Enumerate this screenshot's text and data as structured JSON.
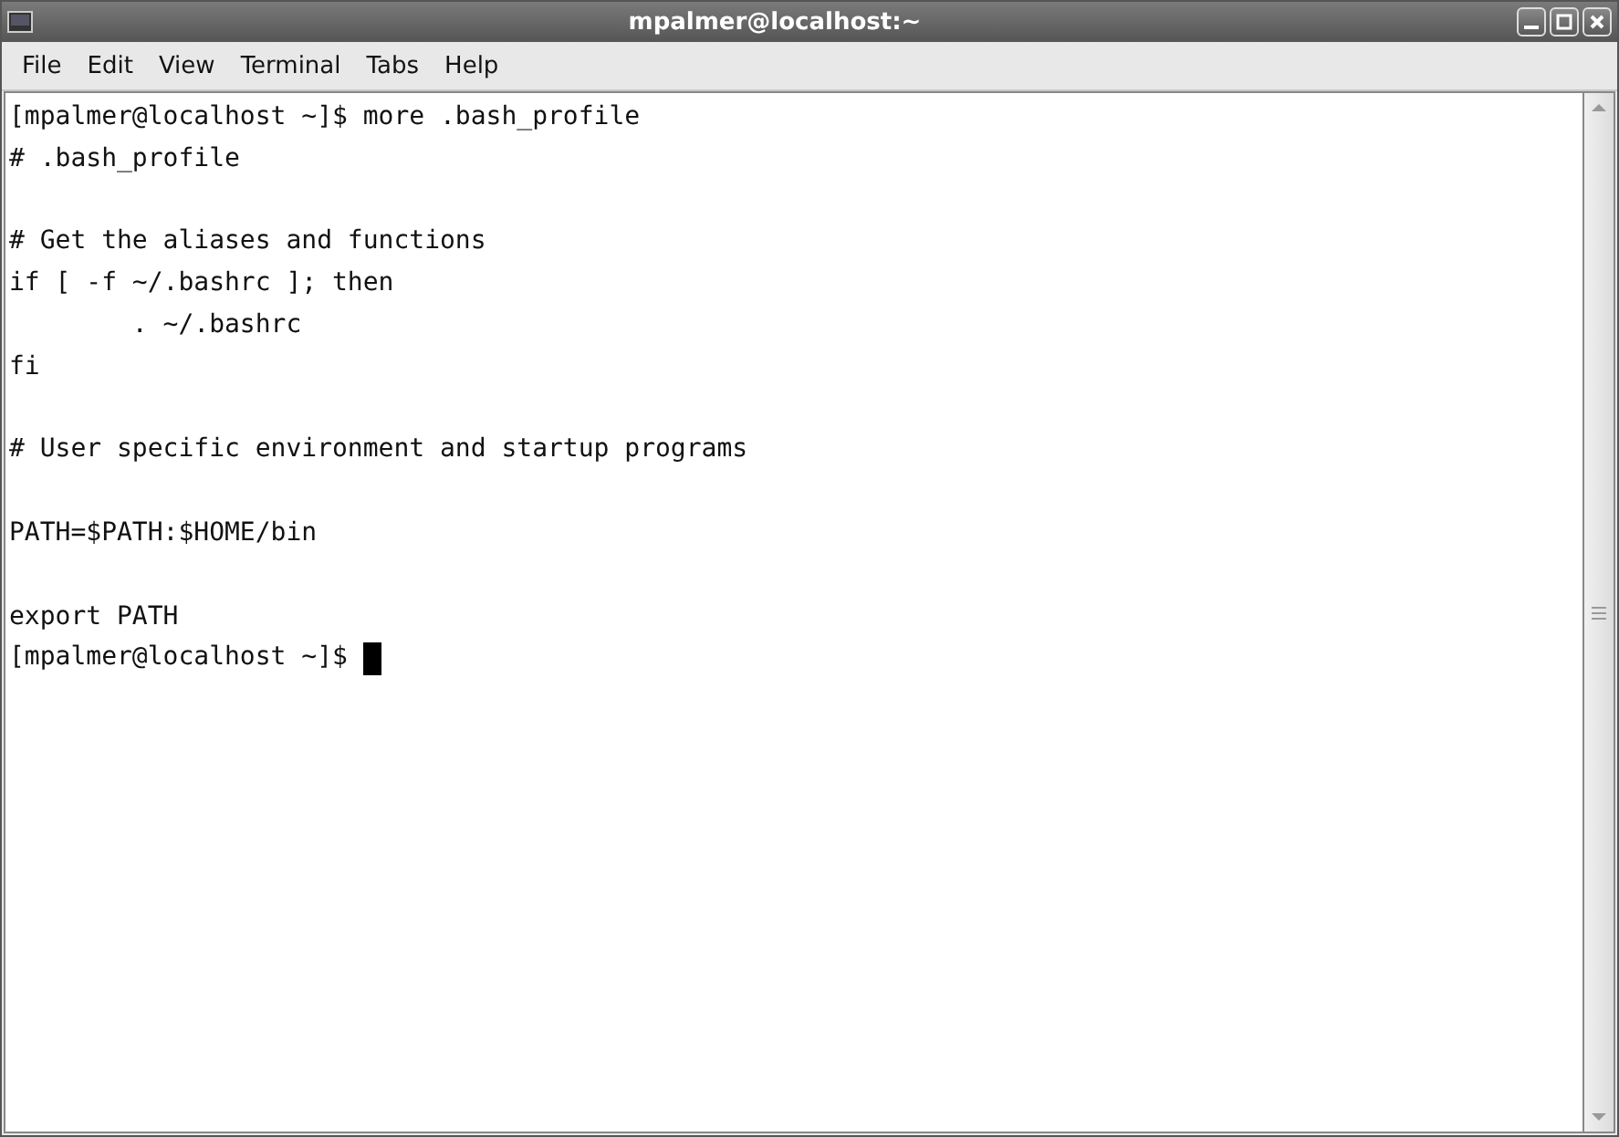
{
  "window": {
    "title": "mpalmer@localhost:~"
  },
  "menu": [
    {
      "label": "File"
    },
    {
      "label": "Edit"
    },
    {
      "label": "View"
    },
    {
      "label": "Terminal"
    },
    {
      "label": "Tabs"
    },
    {
      "label": "Help"
    }
  ],
  "terminal": {
    "lines": [
      {
        "kind": "text",
        "text": "[mpalmer@localhost ~]$ more .bash_profile"
      },
      {
        "kind": "text",
        "text": "# .bash_profile"
      },
      {
        "kind": "blank"
      },
      {
        "kind": "text",
        "text": "# Get the aliases and functions"
      },
      {
        "kind": "text",
        "text": "if [ -f ~/.bashrc ]; then"
      },
      {
        "kind": "text",
        "text": "        . ~/.bashrc"
      },
      {
        "kind": "text",
        "text": "fi"
      },
      {
        "kind": "blank"
      },
      {
        "kind": "text",
        "text": "# User specific environment and startup programs"
      },
      {
        "kind": "blank"
      },
      {
        "kind": "text",
        "text": "PATH=$PATH:$HOME/bin"
      },
      {
        "kind": "blank"
      },
      {
        "kind": "text",
        "text": "export PATH"
      },
      {
        "kind": "text",
        "text": "[mpalmer@localhost ~]$ "
      }
    ],
    "cursor": true
  }
}
